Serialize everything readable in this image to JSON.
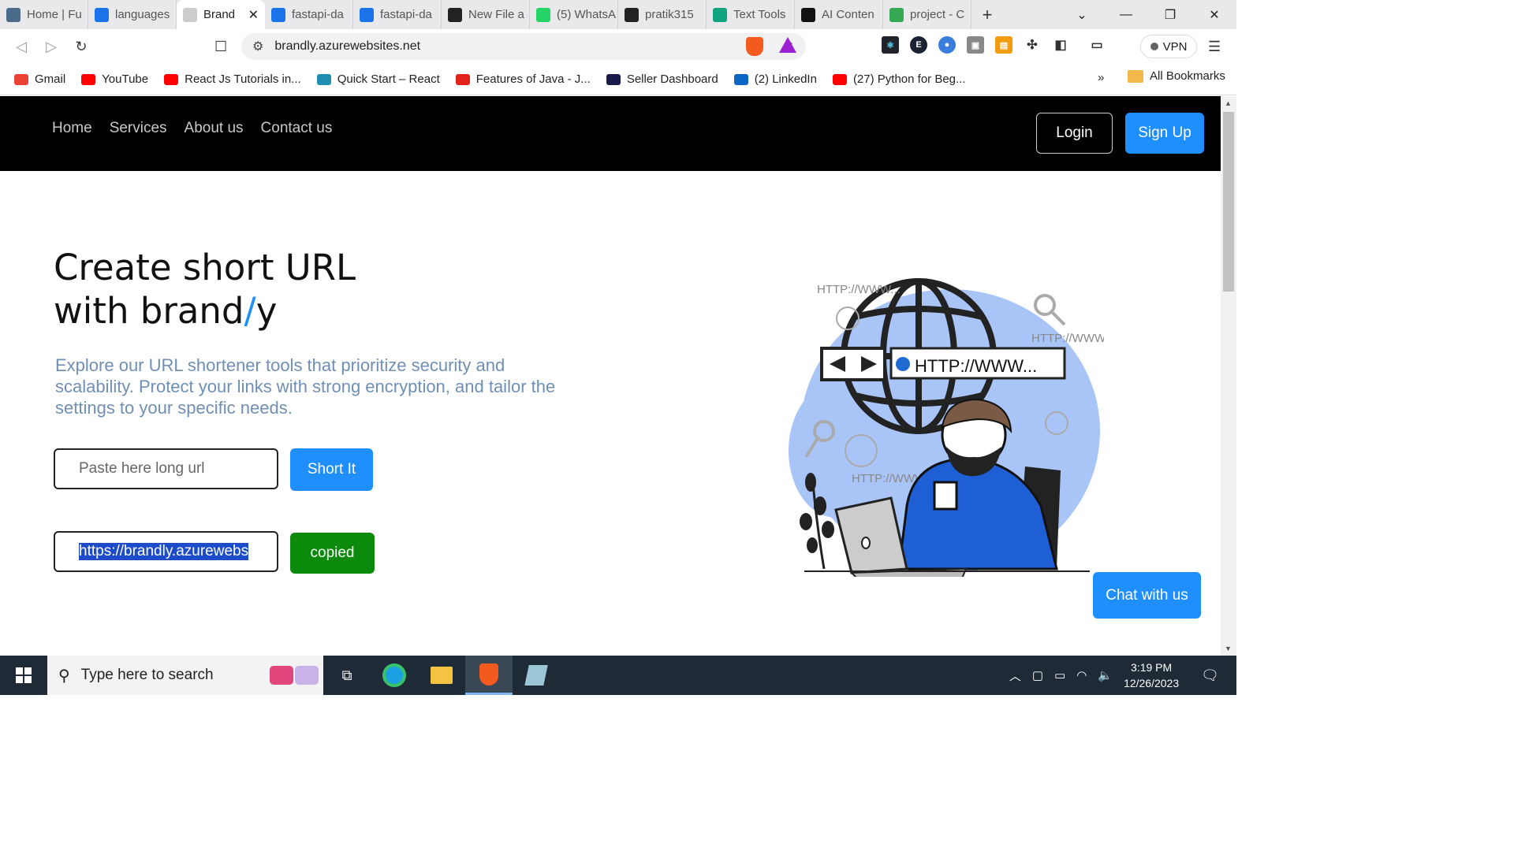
{
  "browser": {
    "tabs": [
      {
        "label": "Home | Fu",
        "color": "#4a6b8a"
      },
      {
        "label": "languages",
        "color": "#1a73e8"
      },
      {
        "label": "Brand",
        "color": "#cccccc",
        "active": true
      },
      {
        "label": "fastapi-da",
        "color": "#1a73e8"
      },
      {
        "label": "fastapi-da",
        "color": "#1a73e8"
      },
      {
        "label": "New File a",
        "color": "#222222"
      },
      {
        "label": "(5) WhatsA",
        "color": "#25d366"
      },
      {
        "label": "pratik315",
        "color": "#222222"
      },
      {
        "label": "Text Tools",
        "color": "#10a37f"
      },
      {
        "label": "AI Conten",
        "color": "#111111"
      },
      {
        "label": "project - C",
        "color": "#34a853"
      }
    ],
    "url": "brandly.azurewebsites.net",
    "vpn_label": "VPN",
    "bookmarks": [
      {
        "label": "Gmail",
        "color": "#ea4335"
      },
      {
        "label": "YouTube",
        "color": "#ff0000"
      },
      {
        "label": "React Js Tutorials in...",
        "color": "#ff0000"
      },
      {
        "label": "Quick Start – React",
        "color": "#1f8fb0"
      },
      {
        "label": "Features of Java - J...",
        "color": "#e2231a"
      },
      {
        "label": "Seller Dashboard",
        "color": "#1a1a4a"
      },
      {
        "label": "(2) LinkedIn",
        "color": "#0a66c2"
      },
      {
        "label": "(27) Python for Beg...",
        "color": "#ff0000"
      }
    ],
    "bookmarks_more": "»",
    "all_bookmarks": "All Bookmarks"
  },
  "site": {
    "nav": [
      "Home",
      "Services",
      "About us",
      "Contact us"
    ],
    "login": "Login",
    "signup": "Sign Up",
    "title_line1": "Create short URL",
    "title_line2_a": "with brand",
    "title_line2_slash": "/",
    "title_line2_b": "y",
    "description": "Explore our URL shortener tools that prioritize security and scalability. Protect your links with strong encryption, and tailor the settings to your specific needs.",
    "input_placeholder": "Paste here long url",
    "short_button": "Short It",
    "output_value": "https://brandly.azurewebs",
    "copied_button": "copied",
    "chat_button": "Chat with us",
    "illustration": {
      "url_bar_text": "HTTP://WWW...",
      "labels": [
        "HTTP://WWW...",
        "HTTP://WWW...",
        "HTTP://WWW..."
      ]
    }
  },
  "taskbar": {
    "search_placeholder": "Type here to search",
    "time": "3:19 PM",
    "date": "12/26/2023"
  }
}
